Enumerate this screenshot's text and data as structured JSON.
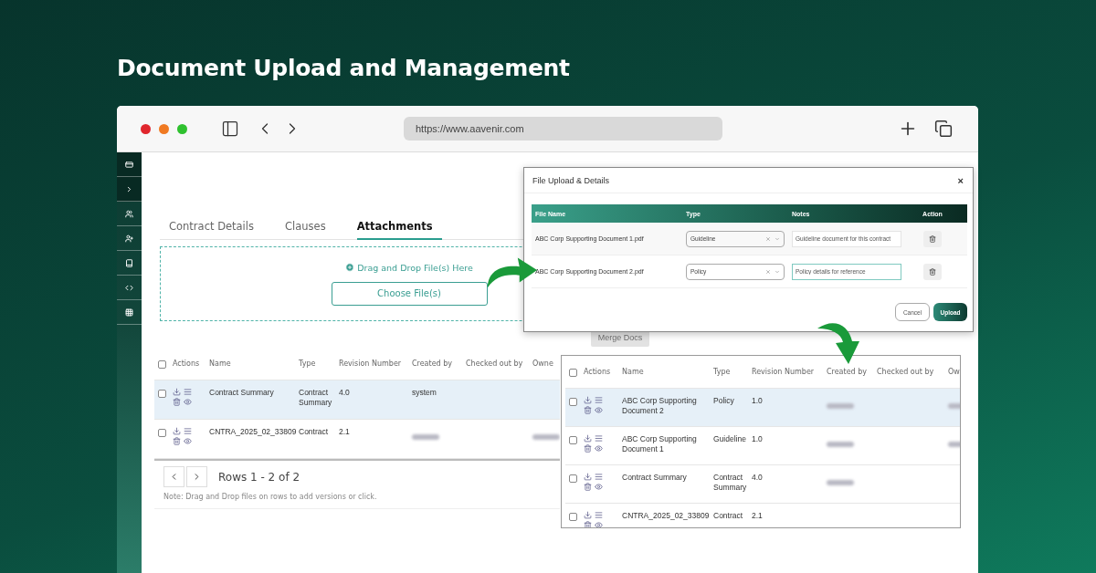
{
  "headline": "Document Upload and Management",
  "browser": {
    "url": "https://www.aavenir.com"
  },
  "tabs": [
    {
      "label": "Contract Details",
      "selected": false
    },
    {
      "label": "Clauses",
      "selected": false
    },
    {
      "label": "Attachments",
      "selected": true
    }
  ],
  "dropzone": {
    "hint": "Drag and Drop File(s) Here",
    "button": "Choose File(s)"
  },
  "merge_button": {
    "label": "Merge Docs",
    "disabled": true
  },
  "documents_table": {
    "all_checked": false,
    "columns": [
      "Actions",
      "Name",
      "Type",
      "Revision Number",
      "Created by",
      "Checked out by",
      "Owne"
    ],
    "rows": [
      {
        "name": "Contract Summary",
        "type": "Contract Summary",
        "revision": "4.0",
        "created_by": "system",
        "selected": true,
        "checked": false
      },
      {
        "name": "CNTRA_2025_02_33809",
        "type": "Contract",
        "revision": "2.1",
        "created_by_redacted": true,
        "owner_redacted": true,
        "selected": false,
        "checked": false
      }
    ]
  },
  "pagination": {
    "summary": "Rows 1 - 2 of 2",
    "note": "Note: Drag and Drop files on rows to add versions or click."
  },
  "upload_dialog": {
    "title": "File Upload & Details",
    "close": "×",
    "columns": [
      "File Name",
      "Type",
      "Notes",
      "Action"
    ],
    "files": [
      {
        "name": "ABC Corp Supporting Document 1.pdf",
        "type": "Guideline",
        "notes": "Guideline document for this contract",
        "focused": false
      },
      {
        "name": "ABC Corp Supporting Document 2.pdf",
        "type": "Policy",
        "notes": "Policy details for reference",
        "focused": true
      }
    ],
    "cancel": "Cancel",
    "upload": "Upload"
  },
  "result_table": {
    "all_checked": false,
    "columns": [
      "Actions",
      "Name",
      "Type",
      "Revision Number",
      "Created by",
      "Checked out by",
      "Ow"
    ],
    "rows": [
      {
        "name": "ABC Corp Supporting Document 2",
        "type": "Policy",
        "revision": "1.0",
        "created_by_redacted": true,
        "owner_redacted": true,
        "selected": true,
        "checked": false
      },
      {
        "name": "ABC Corp Supporting Document 1",
        "type": "Guideline",
        "revision": "1.0",
        "created_by_redacted": true,
        "owner_redacted": true,
        "selected": false,
        "checked": false
      },
      {
        "name": "Contract Summary",
        "type": "Contract Summary",
        "revision": "4.0",
        "created_by_redacted": true,
        "selected": false,
        "checked": false
      },
      {
        "name": "CNTRA_2025_02_33809",
        "type": "Contract",
        "revision": "2.1",
        "selected": false,
        "checked": false
      }
    ]
  }
}
